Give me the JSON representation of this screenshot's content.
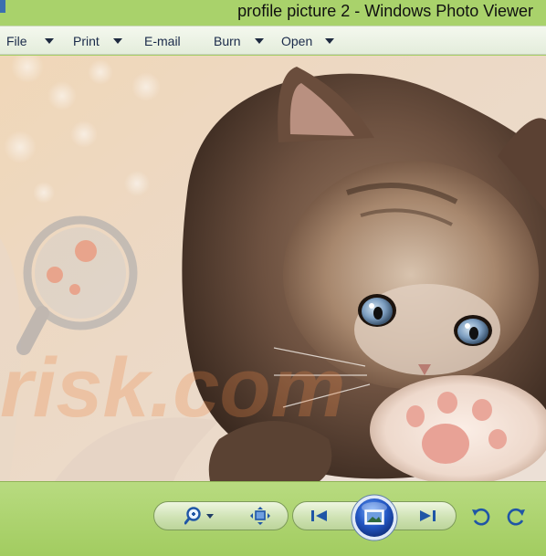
{
  "window": {
    "title": "profile picture 2 - Windows Photo Viewer"
  },
  "menu": [
    {
      "label": "File"
    },
    {
      "label": "Print"
    },
    {
      "label": "E-mail"
    },
    {
      "label": "Burn"
    },
    {
      "label": "Open"
    }
  ],
  "photo": {
    "subject": "kitten",
    "watermark_text": "risk.com"
  },
  "controls": {
    "zoom": "magnifier-icon",
    "actual_size": "fit-to-window-icon",
    "previous": "previous-icon",
    "slideshow": "slideshow-icon",
    "next": "next-icon",
    "rotate_ccw": "rotate-counterclockwise-icon",
    "rotate_cw": "rotate-clockwise-icon"
  },
  "colors": {
    "frame_green": "#a6cf66",
    "menu_bg": "#eef4e6",
    "control_blue": "#2a5fb0"
  }
}
